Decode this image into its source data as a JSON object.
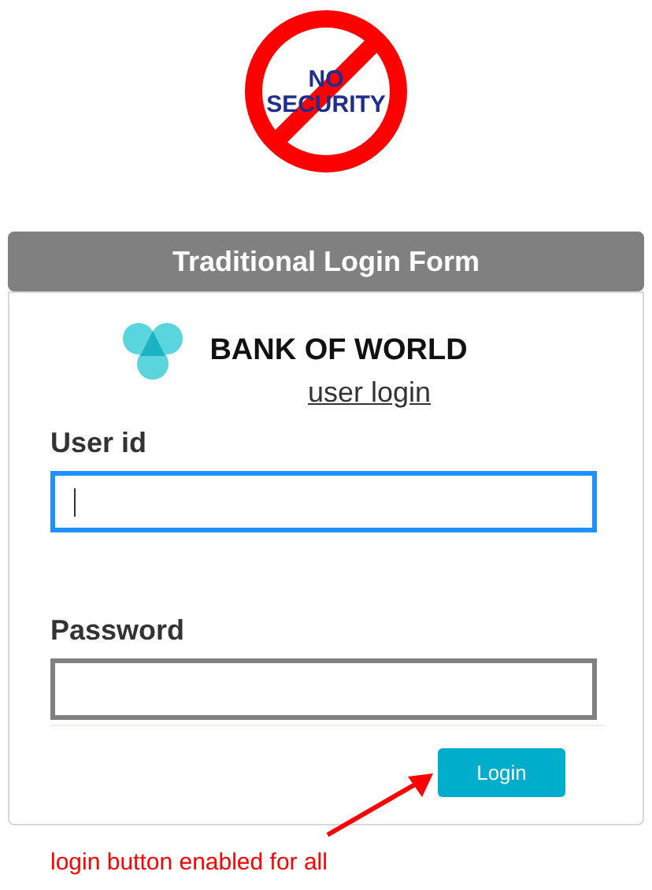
{
  "sign": {
    "lines": [
      "NO",
      "SECURITY"
    ]
  },
  "form": {
    "title": "Traditional Login Form",
    "bank_name": "BANK OF WORLD",
    "subtitle": "user login",
    "fields": [
      {
        "label": "User id",
        "focused": true
      },
      {
        "label": "Password",
        "focused": false
      }
    ],
    "login_button": {
      "label": "Login",
      "enabled": true
    }
  },
  "annotation": "login button enabled for all"
}
